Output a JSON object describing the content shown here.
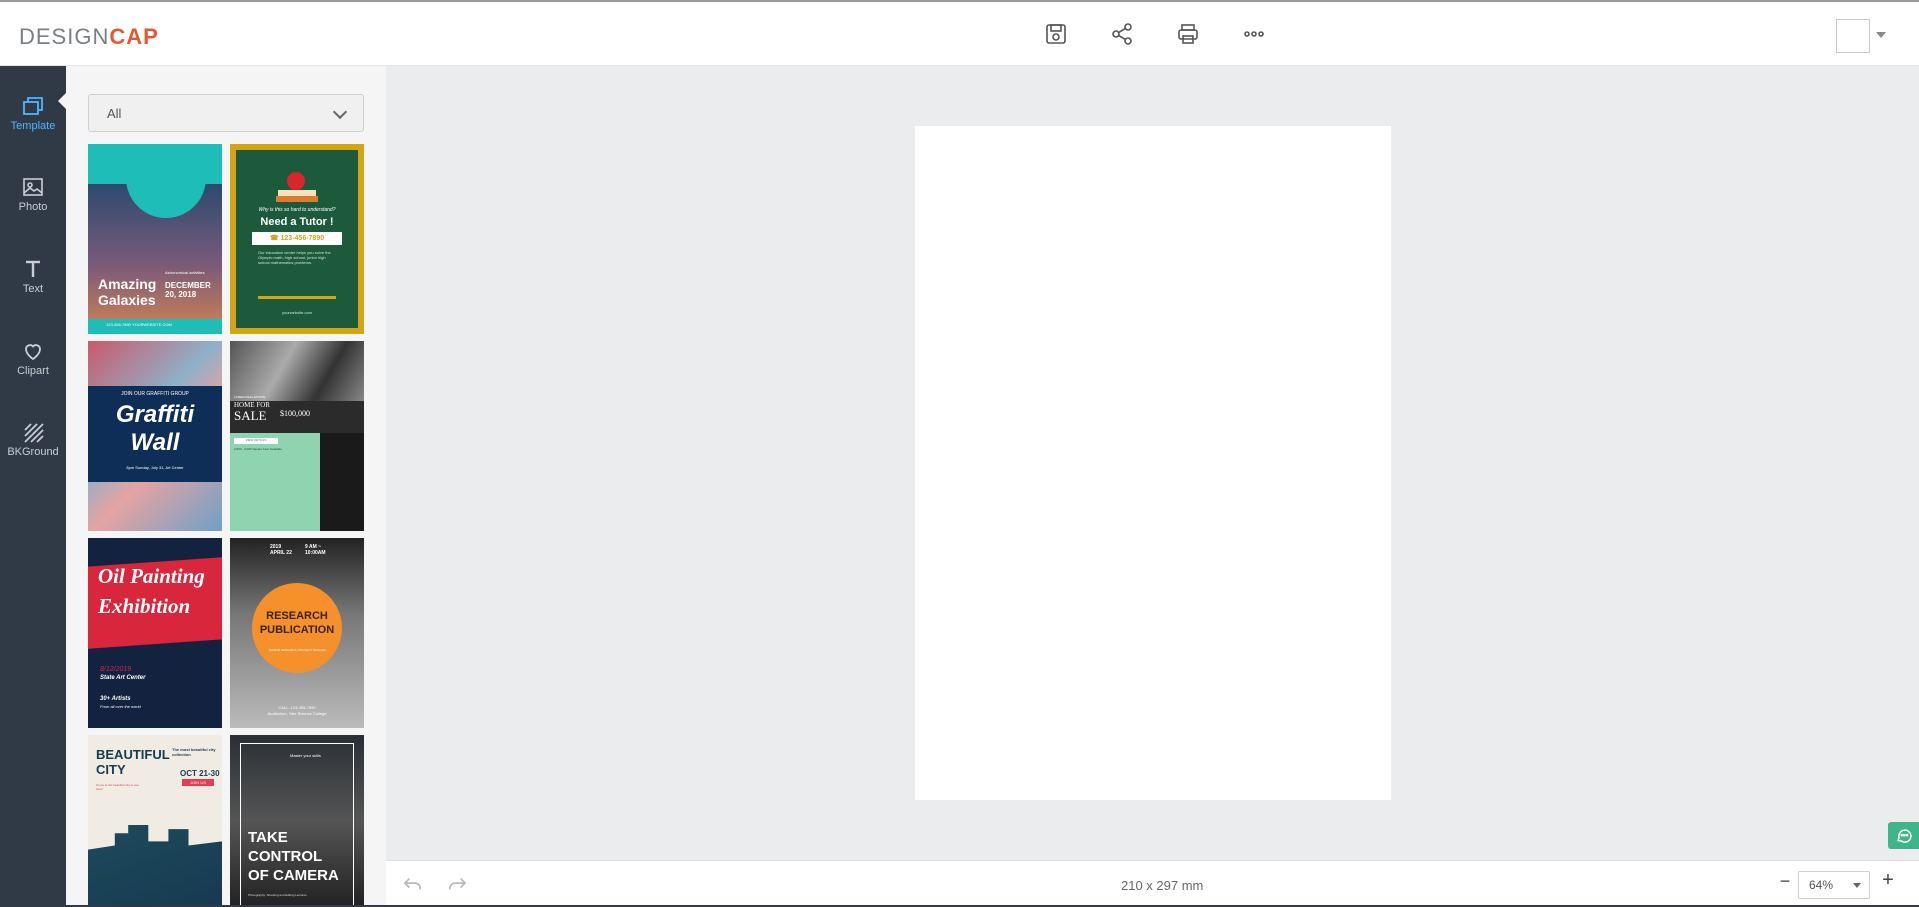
{
  "app": {
    "logo_part1": "DESIGN",
    "logo_part2": "CAP"
  },
  "toolbar": {
    "icons": [
      "save-icon",
      "share-icon",
      "print-icon",
      "more-icon"
    ]
  },
  "sidebar": {
    "items": [
      {
        "label": "Template",
        "icon": "template-icon",
        "active": true
      },
      {
        "label": "Photo",
        "icon": "photo-icon"
      },
      {
        "label": "Text",
        "icon": "text-icon"
      },
      {
        "label": "Clipart",
        "icon": "clipart-icon"
      },
      {
        "label": "BKGround",
        "icon": "background-icon"
      }
    ],
    "settings_icon": "gear-icon"
  },
  "panel": {
    "category_selected": "All",
    "templates": [
      {
        "name": "Amazing Galaxies",
        "title": "Amazing Galaxies",
        "sub": "DECEMBER 20, 2018",
        "side": "Astronomical activities",
        "footer": "123-456-7890    YOURWEBSITE.COM"
      },
      {
        "name": "Need a Tutor",
        "question": "Why is this so hard to understand?",
        "title": "Need a Tutor !",
        "phone": "☎ 123-456-7890",
        "body": "Our education center helps you solve the Olympic math, high school, junior high school mathematics problems.",
        "footer": "yourwebsite.com"
      },
      {
        "name": "Graffiti Wall",
        "top": "JOIN OUR GRAFFITI GROUP",
        "title1": "Graffiti",
        "title2": "Wall",
        "sub": "8pm Sunday, July 31, Art Center"
      },
      {
        "name": "Home For Sale",
        "small": "LOREM REAL ESTATE",
        "title1": "HOME FOR",
        "title2": "SALE",
        "price": "$100,000",
        "tag": "VIEW DETAILS",
        "info": "2,000 - 3,000 Square Feet Available"
      },
      {
        "name": "Oil Painting Exhibition",
        "title1": "Oil Painting",
        "title2": "Exhibition",
        "date": "8/12/2019",
        "place": "State Art Center",
        "count": "30+ Artists",
        "from": "From all over the world"
      },
      {
        "name": "Research Publication",
        "date": "2019 APRIL 22",
        "time": "9 AM ~ 10:00AM",
        "title1": "RESEARCH",
        "title2": "PUBLICATION",
        "sub": "SENIOR RESEARCH PROJECT SPEECH",
        "footer": "CALL: 123-456-7890",
        "footer2": "Auditorium, Yale Science College"
      },
      {
        "name": "Beautiful City",
        "title1": "BEAUTIFUL",
        "title2": "CITY",
        "side": "The most beautiful city collection",
        "date": "OCT 21-30",
        "tag": "JOIN US",
        "note": "Come to the beautiful city to see here!"
      },
      {
        "name": "Take Control of Camera",
        "top": "Master your skills",
        "title1": "TAKE",
        "title2": "CONTROL",
        "title3": "OF CAMERA",
        "footer": "Photography: Shooting and Editing Lectures"
      }
    ]
  },
  "canvas": {
    "size_label": "210 x 297 mm"
  },
  "bottombar": {
    "zoom": "64%",
    "minus": "−",
    "plus": "+"
  },
  "colors": {
    "accent": "#4fb6ff",
    "brand_orange": "#e35a2e",
    "sidebar_bg": "#2f3a46",
    "chat_green": "#3fb58a"
  }
}
